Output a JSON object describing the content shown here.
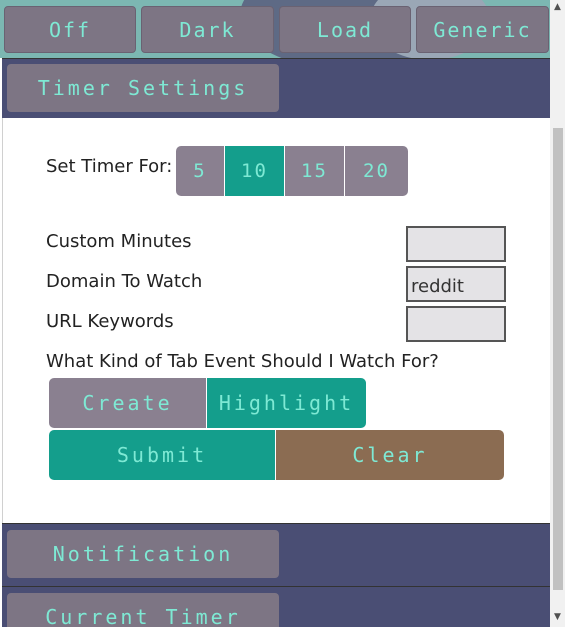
{
  "top_bar": {
    "buttons": [
      "Off",
      "Dark",
      "Load",
      "Generic"
    ]
  },
  "sections": {
    "timer_settings": "Timer Settings",
    "notification": "Notification",
    "current_timer": "Current Timer"
  },
  "timer": {
    "set_timer_label": "Set Timer For:",
    "presets": [
      "5",
      "10",
      "15",
      "20"
    ],
    "selected_preset": "10"
  },
  "fields": {
    "custom_minutes_label": "Custom Minutes",
    "custom_minutes_value": "",
    "domain_label": "Domain To Watch",
    "domain_value": "reddit",
    "keywords_label": "URL Keywords",
    "keywords_value": ""
  },
  "tab_event": {
    "question": "What Kind of Tab Event Should I Watch For?",
    "options": [
      "Create",
      "Highlight"
    ],
    "selected": "Highlight"
  },
  "actions": {
    "submit": "Submit",
    "clear": "Clear"
  },
  "colors": {
    "accent_text": "#7ee9d4",
    "active_teal": "#149e8c",
    "inactive_grey": "#8a8090",
    "header_navy": "#4a4e74",
    "clear_brown": "#8b6c52"
  }
}
